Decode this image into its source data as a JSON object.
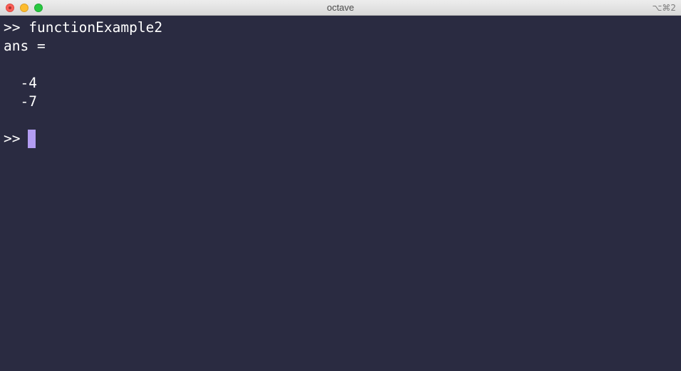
{
  "window": {
    "title": "octave",
    "shortcut": "⌥⌘2"
  },
  "colors": {
    "background": "#2a2b41",
    "text": "#ffffff",
    "cursor": "#b39df3"
  },
  "terminal": {
    "lines": [
      ">> functionExample2",
      "ans =",
      "",
      "  -4",
      "  -7",
      ""
    ],
    "prompt": ">>"
  }
}
